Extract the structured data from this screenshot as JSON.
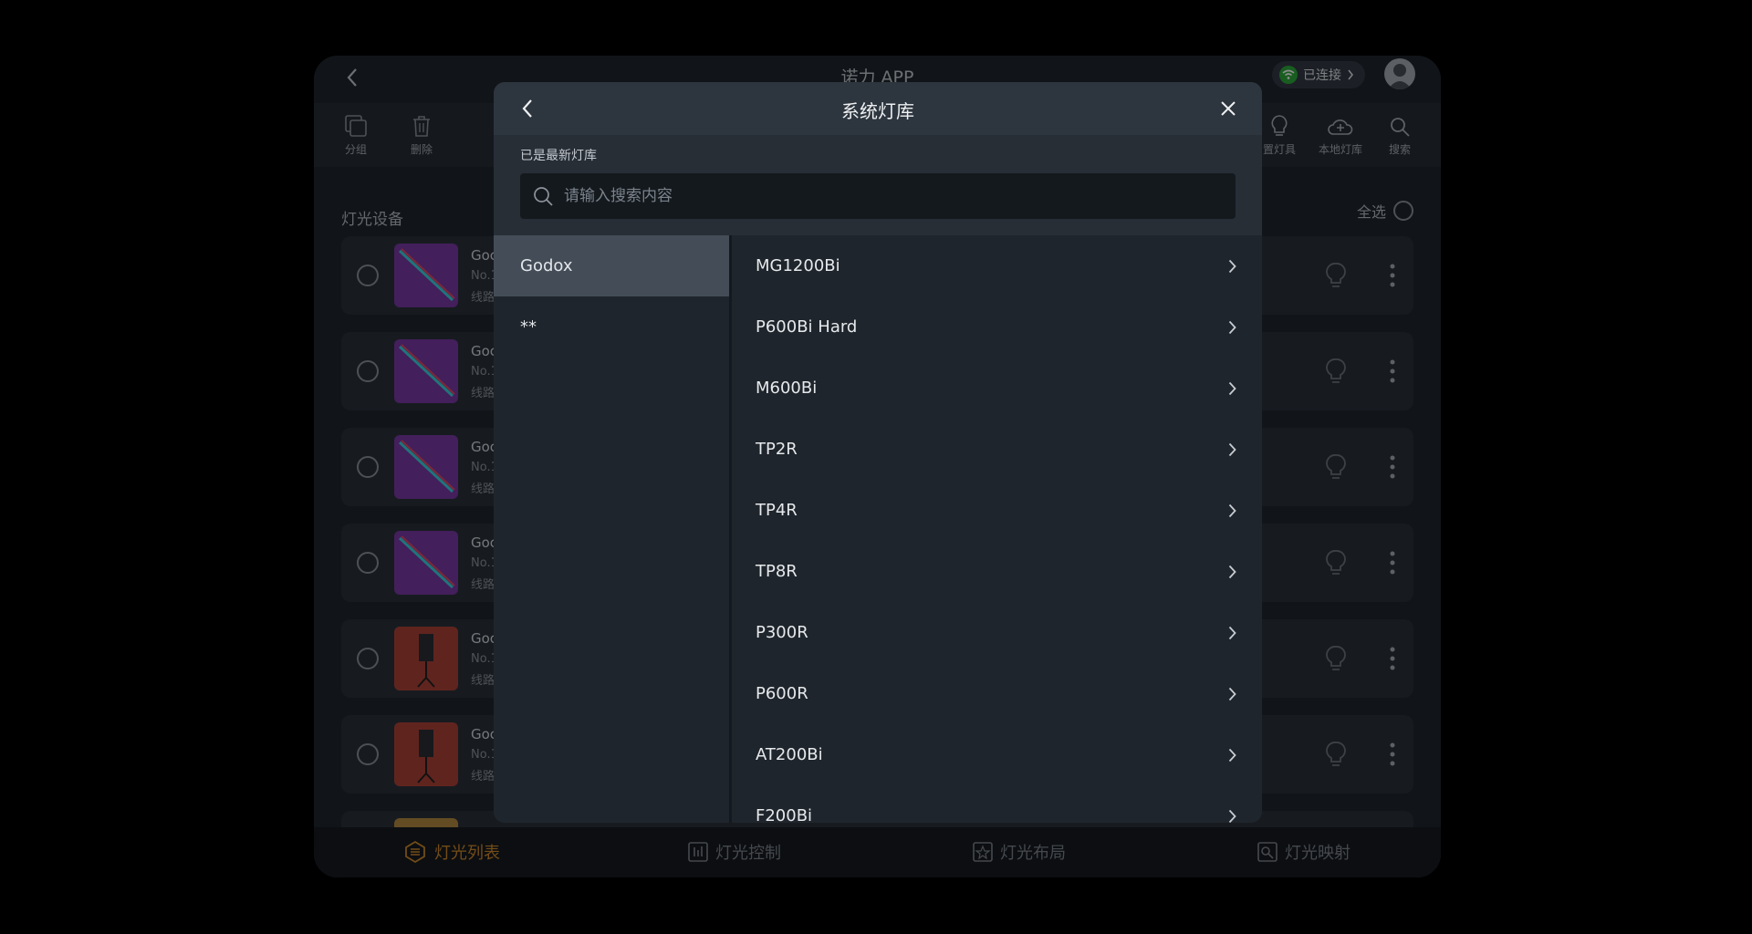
{
  "app": {
    "title": "诺力 APP",
    "connection_status": "已连接",
    "toolbar": {
      "group_label": "分组",
      "delete_label": "删除",
      "fixture_label": "置灯具",
      "local_library_label": "本地灯库",
      "search_label": "搜索"
    },
    "section_label": "灯光设备",
    "select_all_label": "全选",
    "devices": [
      {
        "name": "Goc",
        "no": "No.1",
        "line": "线路"
      },
      {
        "name": "Goc",
        "no": "No.1",
        "line": "线路"
      },
      {
        "name": "Goc",
        "no": "No.1",
        "line": "线路"
      },
      {
        "name": "Goc",
        "no": "No.1",
        "line": "线路"
      },
      {
        "name": "Goc",
        "no": "No.1",
        "line": "线路"
      },
      {
        "name": "Goc",
        "no": "No.1",
        "line": "线路"
      }
    ],
    "bottom_nav": {
      "list": "灯光列表",
      "control": "灯光控制",
      "layout": "灯光布局",
      "mapping": "灯光映射"
    }
  },
  "modal": {
    "title": "系统灯库",
    "status_text": "已是最新灯库",
    "search_placeholder": "请输入搜索内容",
    "brands": [
      "Godox",
      "**"
    ],
    "selected_brand": "Godox",
    "models": [
      "MG1200Bi",
      "P600Bi Hard",
      "M600Bi",
      "TP2R",
      "TP4R",
      "TP8R",
      "P300R",
      "P600R",
      "AT200Bi",
      "F200Bi"
    ]
  },
  "colors": {
    "accent": "#d18a2c",
    "connected": "#2faa3b",
    "modal_header": "#2d353e",
    "selected_brand": "#444d57"
  }
}
